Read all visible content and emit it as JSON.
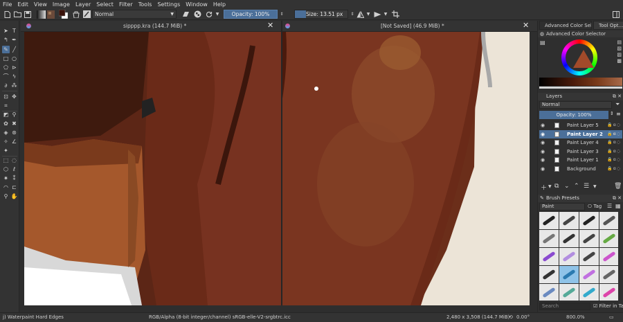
{
  "menu": [
    "File",
    "Edit",
    "View",
    "Image",
    "Layer",
    "Select",
    "Filter",
    "Tools",
    "Settings",
    "Window",
    "Help"
  ],
  "toolbar": {
    "blend_mode": "Normal",
    "opacity_label": "Opacity: 100%",
    "opacity_fraction": 1.0,
    "size_label": "Size: 13.51 px"
  },
  "documents": [
    {
      "title": "sipppp.kra (144.7 MiB) *"
    },
    {
      "title": "[Not Saved]  (46.9 MiB) *"
    }
  ],
  "dock": {
    "tabs": [
      "Advanced Color Sele...",
      "Tool Opt..."
    ],
    "color_panel_title": "Advanced Color Selector",
    "layers_panel_title": "Layers",
    "layer_blend": "Normal",
    "layer_opacity": "Opacity:  100%",
    "layers": [
      {
        "name": "Paint Layer 5",
        "selected": false
      },
      {
        "name": "Paint Layer 2",
        "selected": true
      },
      {
        "name": "Paint Layer 4",
        "selected": false
      },
      {
        "name": "Paint Layer 3",
        "selected": false
      },
      {
        "name": "Paint Layer 1",
        "selected": false
      },
      {
        "name": "Background",
        "selected": false
      }
    ],
    "brush_panel_title": "Brush Presets",
    "brush_filter": "Paint",
    "tag_label": "Tag",
    "search_placeholder": "Search",
    "filter_in_tag": "Filter in Tag"
  },
  "status": {
    "brush_name": "j) Waterpaint Hard Edges",
    "color_profile": "RGB/Alpha (8-bit integer/channel)  sRGB-elle-V2-srgbtrc.icc",
    "image_size": "2,480 x 3,508 (144.7 MiB)",
    "rotation": "0.00°",
    "zoom": "800.0%"
  },
  "colors": {
    "accent": "#4b6f99",
    "panel": "#333333",
    "dark": "#262626"
  }
}
